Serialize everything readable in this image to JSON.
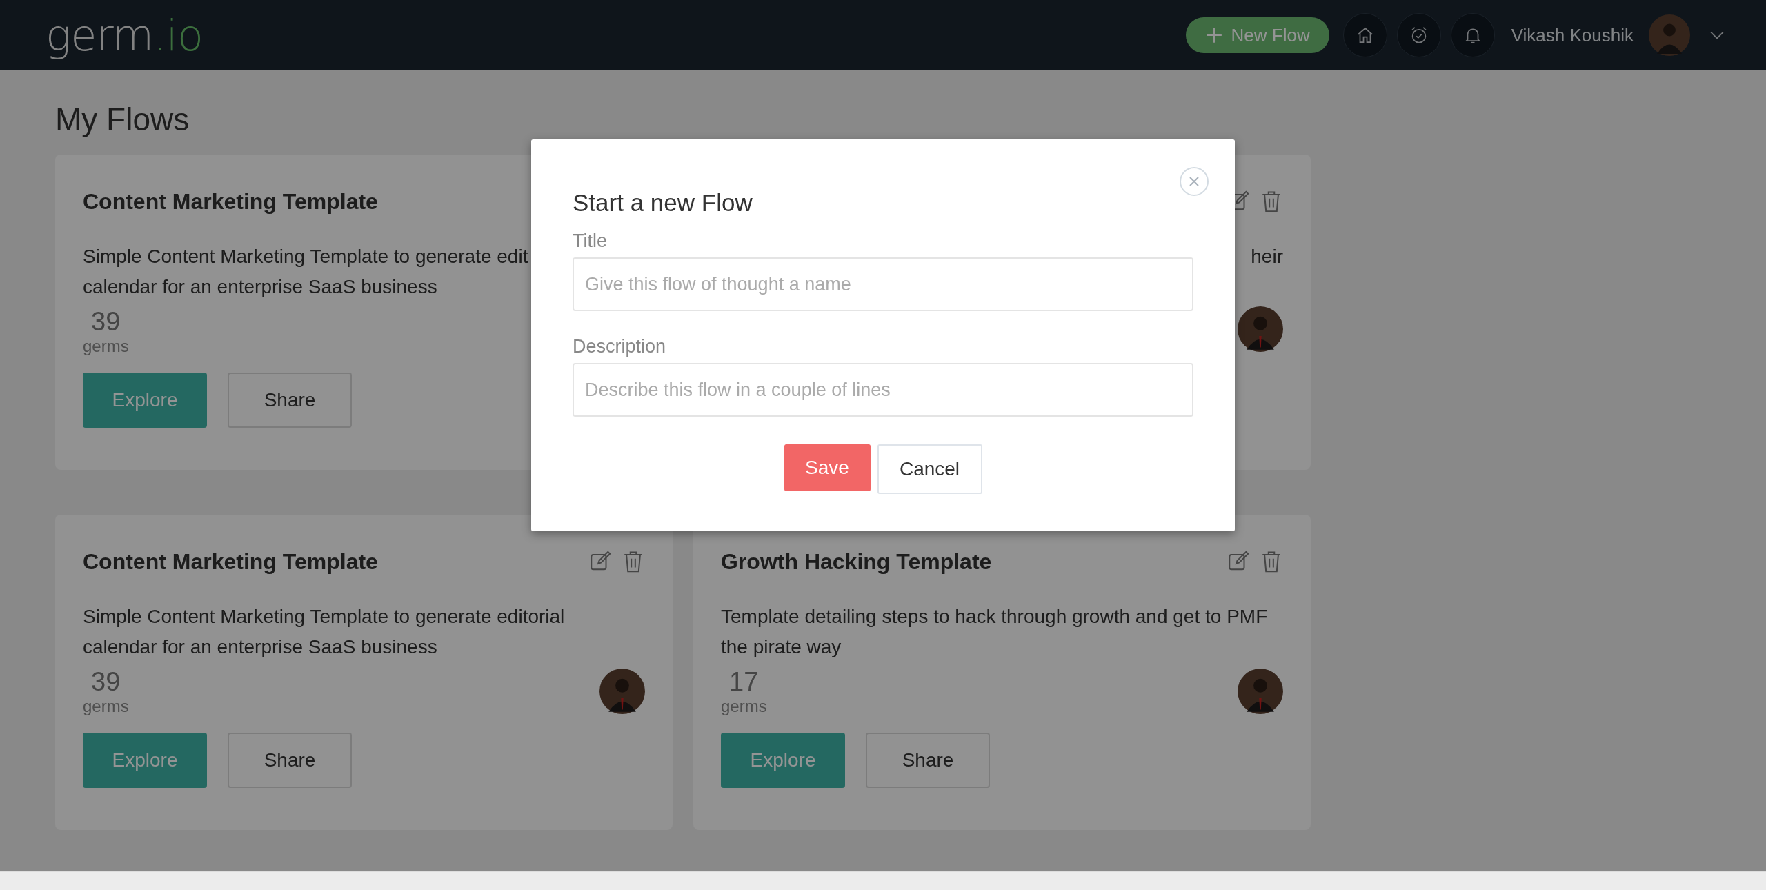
{
  "header": {
    "logo": {
      "word": "germ",
      "suffix": ".io"
    },
    "new_flow_button": {
      "label": "New Flow"
    },
    "user_name": "Vikash Koushik"
  },
  "page_title": "My Flows",
  "cards": [
    {
      "kind": "full",
      "actions": false,
      "avatar": false,
      "title": "Content Marketing Template",
      "description": "Simple Content Marketing Template to generate edit\ncalendar for an enterprise SaaS business",
      "count": "39",
      "count_label": "germs",
      "buttons": [
        "Explore",
        "Share"
      ]
    },
    {
      "kind": "covered",
      "actions": true,
      "avatar": true,
      "description": "heir"
    },
    {
      "kind": "full",
      "actions": true,
      "avatar": true,
      "title": "Content Marketing Template",
      "description": "Simple Content Marketing Template to generate editorial\ncalendar for an enterprise SaaS business",
      "count": "39",
      "count_label": "germs",
      "buttons": [
        "Explore",
        "Share"
      ]
    },
    {
      "kind": "full",
      "actions": true,
      "avatar": true,
      "title": "Growth Hacking Template",
      "description": "Template detailing steps to hack through growth and get to PMF the pirate way",
      "count": "17",
      "count_label": "germs",
      "buttons": [
        "Explore",
        "Share"
      ]
    }
  ],
  "modal": {
    "title": "Start a new Flow",
    "fields": [
      {
        "label": "Title",
        "placeholder": "Give this flow of thought a name"
      },
      {
        "label": "Description",
        "placeholder": "Describe this flow in a couple of lines"
      }
    ],
    "save": "Save",
    "cancel": "Cancel"
  }
}
